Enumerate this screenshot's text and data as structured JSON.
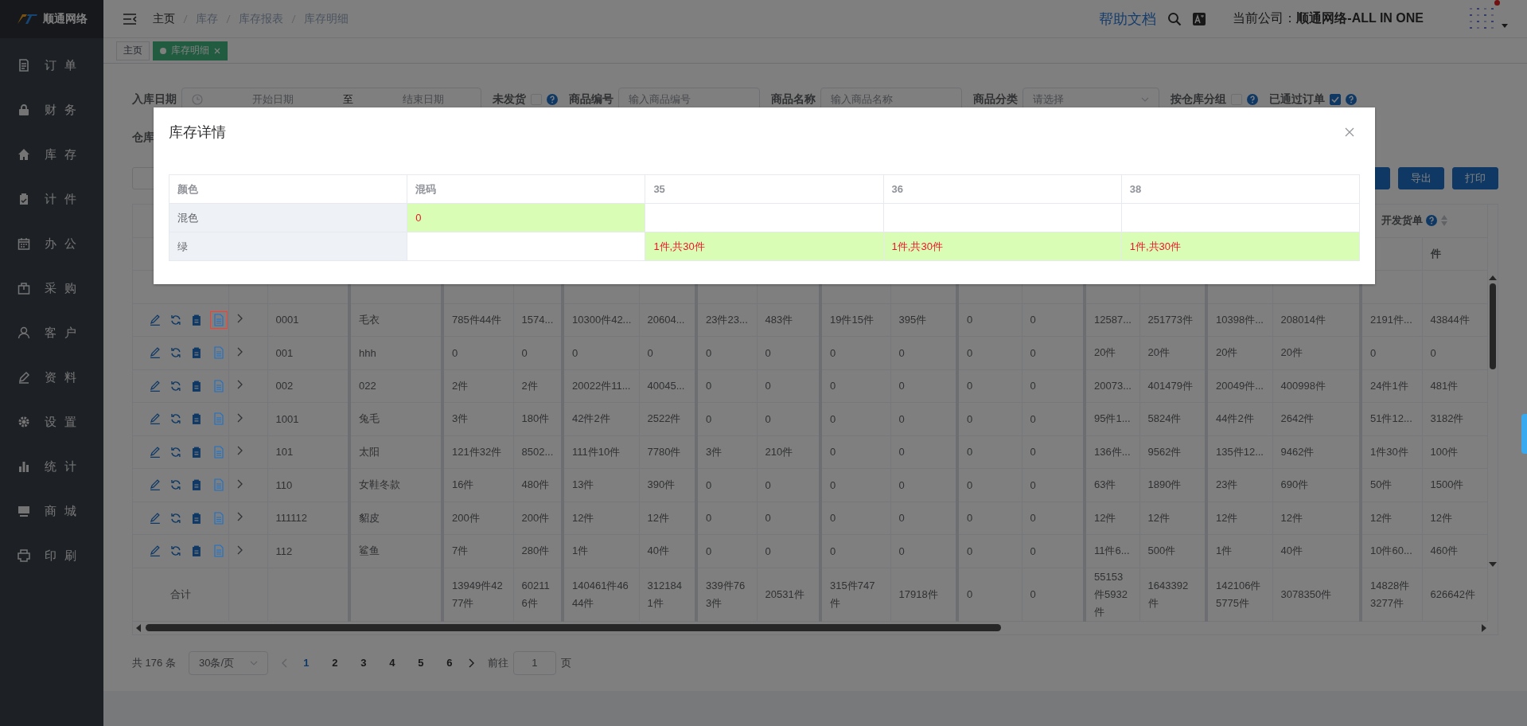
{
  "sidebar": {
    "logo_text": "顺通网络",
    "items": [
      {
        "label": "订单"
      },
      {
        "label": "财务"
      },
      {
        "label": "库存"
      },
      {
        "label": "计件"
      },
      {
        "label": "办公"
      },
      {
        "label": "采购"
      },
      {
        "label": "客户"
      },
      {
        "label": "资料"
      },
      {
        "label": "设置"
      },
      {
        "label": "统计"
      },
      {
        "label": "商城"
      },
      {
        "label": "印刷"
      }
    ]
  },
  "header": {
    "breadcrumb": [
      "主页",
      "库存",
      "库存报表",
      "库存明细"
    ],
    "help_link": "帮助文档",
    "company_label": "当前公司：",
    "company_name": "顺通网络-ALL IN ONE"
  },
  "tabs": [
    {
      "label": "主页",
      "selected": false
    },
    {
      "label": "库存明细",
      "selected": true
    }
  ],
  "filters": [
    {
      "kind": "date_range",
      "label": "入库日期",
      "start_placeholder": "开始日期",
      "between": "至",
      "end_placeholder": "结束日期"
    },
    {
      "kind": "checkbox",
      "label": "未发货",
      "checked": false
    },
    {
      "kind": "input",
      "label": "商品编号",
      "placeholder": "输入商品编号"
    },
    {
      "kind": "input",
      "label": "商品名称",
      "placeholder": "输入商品名称"
    },
    {
      "kind": "select",
      "label": "商品分类",
      "placeholder": "请选择"
    },
    {
      "kind": "checkbox",
      "label": "按仓库分组",
      "checked": false
    },
    {
      "kind": "checkbox",
      "label": "已通过订单",
      "checked": true
    }
  ],
  "filter_row2_label": "仓库",
  "toolbar": {
    "right_buttons": [
      "导出",
      "打印"
    ]
  },
  "table": {
    "header_group": "开发货单",
    "header_unit": "件",
    "rows": [
      {
        "doc_focused": true,
        "cells": [
          "0001",
          "毛衣",
          "785件44件",
          "1574...",
          "10300件42...",
          "20604...",
          "23件23...",
          "483件",
          "19件15件",
          "395件",
          "0",
          "0",
          "12587...",
          "251773件",
          "10398件...",
          "208014件",
          "2191件...",
          "43844件"
        ]
      },
      {
        "doc_focused": false,
        "cells": [
          "001",
          "hhh",
          "0",
          "0",
          "0",
          "0",
          "0",
          "0",
          "0",
          "0",
          "0",
          "0",
          "20件",
          "20件",
          "20件",
          "20件",
          "0",
          "0"
        ]
      },
      {
        "doc_focused": false,
        "cells": [
          "002",
          "022",
          "2件",
          "2件",
          "20022件11...",
          "40045...",
          "0",
          "0",
          "0",
          "0",
          "0",
          "0",
          "20073...",
          "401479件",
          "20049件...",
          "400998件",
          "24件1件",
          "481件"
        ]
      },
      {
        "doc_focused": false,
        "cells": [
          "1001",
          "兔毛",
          "3件",
          "180件",
          "42件2件",
          "2522件",
          "0",
          "0",
          "0",
          "0",
          "0",
          "0",
          "95件1...",
          "5824件",
          "44件2件",
          "2642件",
          "51件12...",
          "3182件"
        ]
      },
      {
        "doc_focused": false,
        "cells": [
          "101",
          "太阳",
          "121件32件",
          "8502...",
          "111件10件",
          "7780件",
          "3件",
          "210件",
          "0",
          "0",
          "0",
          "0",
          "136件...",
          "9562件",
          "135件12...",
          "9462件",
          "1件30件",
          "100件"
        ]
      },
      {
        "doc_focused": false,
        "cells": [
          "110",
          "女鞋冬款",
          "16件",
          "480件",
          "13件",
          "390件",
          "0",
          "0",
          "0",
          "0",
          "0",
          "0",
          "63件",
          "1890件",
          "23件",
          "690件",
          "50件",
          "1500件"
        ]
      },
      {
        "doc_focused": false,
        "cells": [
          "111112",
          "貂皮",
          "200件",
          "200件",
          "12件",
          "12件",
          "0",
          "0",
          "0",
          "0",
          "0",
          "0",
          "12件",
          "12件",
          "12件",
          "12件",
          "12件",
          "12件"
        ]
      },
      {
        "doc_focused": false,
        "cells": [
          "112",
          "鲨鱼",
          "7件",
          "280件",
          "1件",
          "40件",
          "0",
          "0",
          "0",
          "0",
          "0",
          "0",
          "11件6...",
          "500件",
          "1件",
          "40件",
          "10件60...",
          "460件"
        ]
      }
    ],
    "footer": {
      "label": "合计",
      "cells": [
        "13949件4277件",
        "602116件",
        "140461件4644件",
        "3121841件",
        "339件763件",
        "20531件",
        "315件747件",
        "17918件",
        "0",
        "0",
        "55153件5932件",
        "1643392件",
        "142106件5775件",
        "3078350件",
        "14828件3277件",
        "626642件"
      ]
    }
  },
  "pagination": {
    "total": "共 176 条",
    "page_size": "30条/页",
    "pages": [
      {
        "label": "1",
        "selected": true
      },
      {
        "label": "2",
        "selected": false
      },
      {
        "label": "3",
        "selected": false
      },
      {
        "label": "4",
        "selected": false
      },
      {
        "label": "5",
        "selected": false
      },
      {
        "label": "6",
        "selected": false
      }
    ],
    "goto_label": "前往",
    "goto_value": "1",
    "page_suffix": "页"
  },
  "modal": {
    "title": "库存详情",
    "columns": [
      "颜色",
      "混码",
      "35",
      "36",
      "38"
    ],
    "rows": [
      {
        "cells": [
          {
            "text": "混色",
            "highlighted": false
          },
          {
            "text": "0",
            "highlighted": true
          },
          {
            "highlighted": false
          },
          {
            "highlighted": false
          },
          {
            "highlighted": false
          }
        ]
      },
      {
        "cells": [
          {
            "text": "绿",
            "highlighted": false
          },
          {
            "highlighted": false
          },
          {
            "text": "1件,共30件",
            "highlighted": true
          },
          {
            "text": "1件,共30件",
            "highlighted": true
          },
          {
            "text": "1件,共30件",
            "highlighted": true
          }
        ]
      }
    ]
  }
}
